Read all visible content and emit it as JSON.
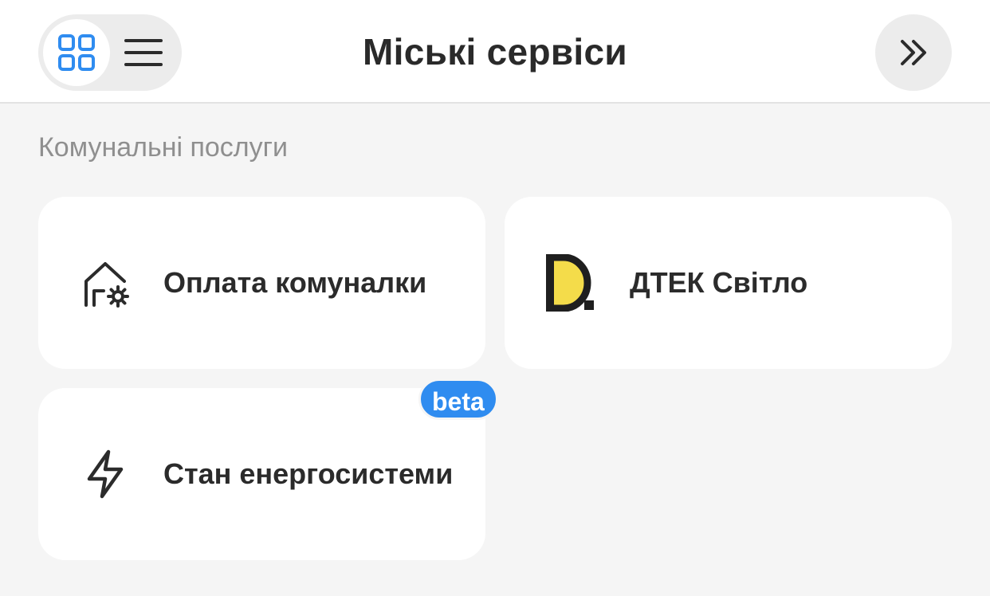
{
  "header": {
    "title": "Міські сервіси",
    "view_toggle": {
      "grid_icon": "grid-view-icon",
      "list_icon": "list-view-icon",
      "selected": "grid"
    },
    "forward_icon": "double-chevron-right-icon"
  },
  "section": {
    "title": "Комунальні послуги"
  },
  "cards": [
    {
      "label": "Оплата комуналки",
      "icon": "house-gear-icon"
    },
    {
      "label": "ДТЕК Світло",
      "icon": "dtek-logo"
    },
    {
      "label": "Стан енергосистеми",
      "icon": "lightning-icon",
      "badge": "beta"
    }
  ],
  "colors": {
    "accent": "#2f8cf0",
    "dtek_yellow": "#f4dc4a",
    "background": "#f5f5f5"
  }
}
